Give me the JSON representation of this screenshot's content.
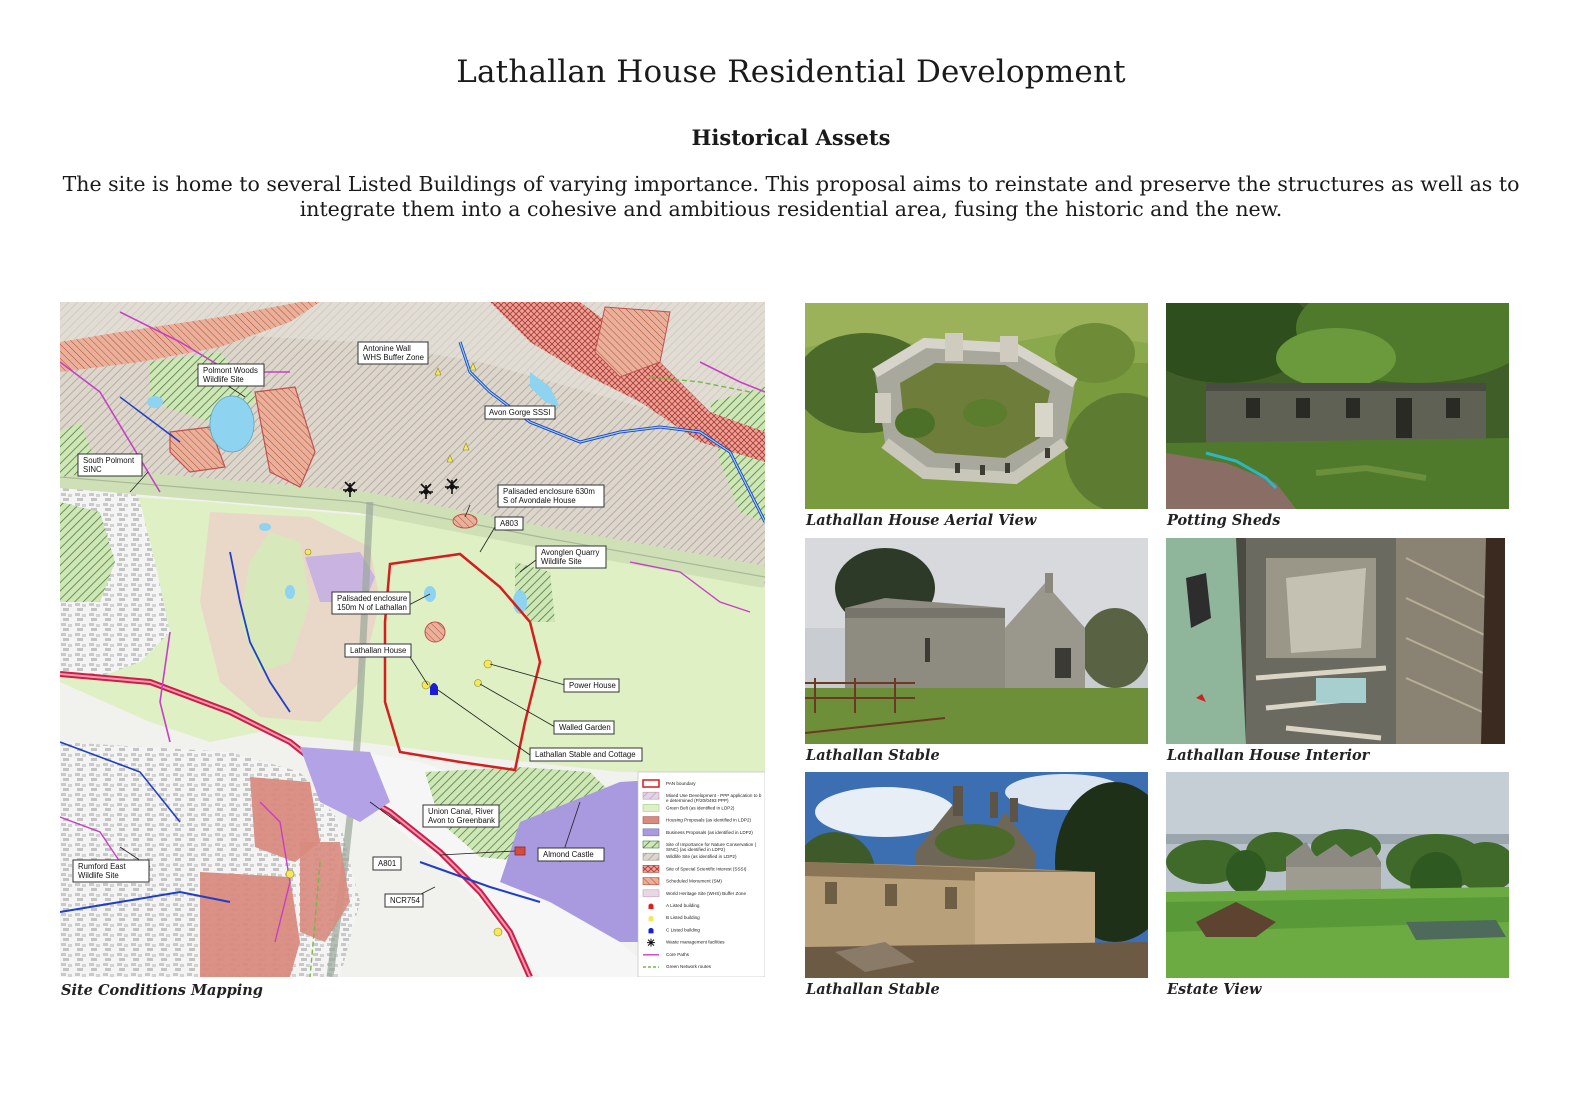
{
  "page": {
    "title": "Lathallan House Residential Development",
    "subtitle": "Historical Assets",
    "intro": "The site is home to several Listed Buildings of varying importance. This proposal aims to reinstate and preserve the structures as well as to integrate them into a cohesive and ambitious residential area, fusing the historic and the new."
  },
  "map": {
    "caption": "Site Conditions Mapping",
    "labels": {
      "polmont_woods": [
        "Polmont Woods",
        "Wildlife Site"
      ],
      "antonine_wall": [
        "Antonine Wall",
        "WHS Buffer Zone"
      ],
      "avon_gorge": "Avon Gorge SSSI",
      "south_polmont": [
        "South Polmont",
        "SINC"
      ],
      "palisaded_630": [
        "Palisaded enclosure 630m",
        "S of Avondale House"
      ],
      "a803": "A803",
      "avonglen": [
        "Avonglen Quarry",
        "Wildlife Site"
      ],
      "palisaded_150": [
        "Palisaded enclosure",
        "150m N of Lathallan"
      ],
      "lathallan_house": "Lathallan House",
      "power_house": "Power House",
      "walled_garden": "Walled Garden",
      "stable_cottage": "Lathallan Stable and Cottage",
      "union_canal": [
        "Union Canal, River",
        "Avon to Greenbank"
      ],
      "almond_castle": "Almond Castle",
      "a801": "A801",
      "ncr754": "NCR754",
      "rumford": [
        "Rumford East",
        "Wildlife Site"
      ]
    },
    "legend": [
      {
        "label": "PAN boundary",
        "swatch": "pan"
      },
      {
        "label": "Mixed Use Development - PPP application to be determined (P/20/0493 PPP)",
        "swatch": "mixed"
      },
      {
        "label": "Green Belt (as identified in LDP2)",
        "swatch": "greenbelt"
      },
      {
        "label": "Housing Proposals (as identified in LDP2)",
        "swatch": "housing"
      },
      {
        "label": "Business Proposals (as identified in LDP2)",
        "swatch": "business"
      },
      {
        "label": "Site of Importance for Nature Conservation (SINC) (as identified in LDP2)",
        "swatch": "sinc"
      },
      {
        "label": "Wildlife Site (as identified in LDP2)",
        "swatch": "wildlife"
      },
      {
        "label": "Site of Special Scientific Interest (SSSI)",
        "swatch": "sssi"
      },
      {
        "label": "Scheduled Monument (SM)",
        "swatch": "sm"
      },
      {
        "label": "World Heritage Site (WHS) Buffer Zone",
        "swatch": "whs"
      },
      {
        "label": "A Listed building",
        "swatch": "a-listed"
      },
      {
        "label": "B Listed building",
        "swatch": "b-listed"
      },
      {
        "label": "C Listed building",
        "swatch": "c-listed"
      },
      {
        "label": "Waste management facilities",
        "swatch": "waste"
      },
      {
        "label": "Core Paths",
        "swatch": "paths"
      },
      {
        "label": "Green Network routes",
        "swatch": "green-network"
      }
    ],
    "colors": {
      "pan_boundary": "#d21f1f",
      "green_belt": "#dff0c4",
      "housing": "#d98b7e",
      "business": "#a99ae0",
      "sssi": "#c0504d",
      "whs_buffer": "#e6d9e6",
      "core_paths": "#c640c6",
      "water": "#8ed3ef",
      "river": "#1f3fc4"
    }
  },
  "photos": [
    {
      "caption": "Lathallan House Aerial View",
      "scene": "aerial-ruin"
    },
    {
      "caption": "Potting Sheds",
      "scene": "potting-sheds"
    },
    {
      "caption": "Lathallan Stable",
      "scene": "stable-exterior"
    },
    {
      "caption": "Lathallan House Interior",
      "scene": "interior"
    },
    {
      "caption": "Lathallan Stable",
      "scene": "stable-ruin"
    },
    {
      "caption": "Estate View",
      "scene": "estate-view"
    }
  ]
}
